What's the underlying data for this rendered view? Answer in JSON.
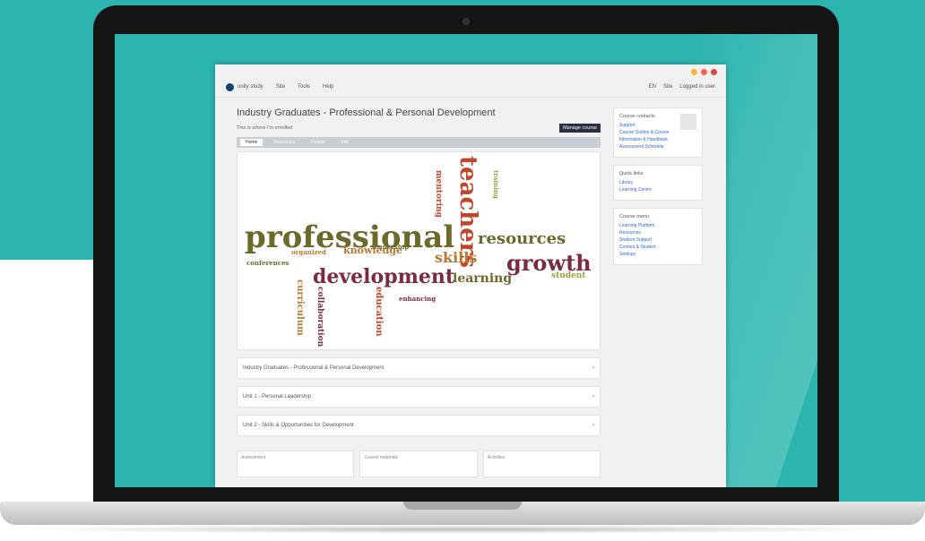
{
  "browser": {
    "traffic_colors": [
      "#f7b733",
      "#ff5f57",
      "#e0443e"
    ]
  },
  "topnav": {
    "brand": "unity study",
    "links": [
      "Site",
      "Tools",
      "Help"
    ],
    "right_items": [
      "EN",
      "Site",
      "Logged in user"
    ]
  },
  "page": {
    "title": "Industry Graduates - Professional & Personal Development",
    "subtitle": "This is where I'm enrolled",
    "action_button": "Manage course"
  },
  "tabs": [
    "Home",
    "Resources",
    "People",
    "Info"
  ],
  "wordcloud": {
    "words": [
      {
        "text": "professional",
        "color": "#6b6a2b"
      },
      {
        "text": "teachers",
        "color": "#c0462b"
      },
      {
        "text": "resources",
        "color": "#6b6a2b"
      },
      {
        "text": "growth",
        "color": "#7a2b3f"
      },
      {
        "text": "development",
        "color": "#7a2b3f"
      },
      {
        "text": "skills",
        "color": "#b9772e"
      },
      {
        "text": "learning",
        "color": "#6b6a2b"
      },
      {
        "text": "knowledge",
        "color": "#b9772e"
      },
      {
        "text": "student",
        "color": "#9aa43a"
      },
      {
        "text": "education",
        "color": "#c0462b"
      },
      {
        "text": "curriculum",
        "color": "#b9772e"
      },
      {
        "text": "conferences",
        "color": "#6b6a2b"
      },
      {
        "text": "collaboration",
        "color": "#7a2b3f"
      },
      {
        "text": "organized",
        "color": "#b9772e"
      },
      {
        "text": "mentoring",
        "color": "#c0462b"
      },
      {
        "text": "training",
        "color": "#9aa43a"
      },
      {
        "text": "enhancing",
        "color": "#7a2b3f"
      },
      {
        "text": "leadership",
        "color": "#6b6a2b"
      }
    ]
  },
  "rows": [
    "Industry Graduates - Professional & Personal Development",
    "Unit 1 - Personal Leadership",
    "Unit 2 - Skills & Opportunities for Development"
  ],
  "cards": [
    "Assessment",
    "Course materials",
    "Activities"
  ],
  "sidebar": {
    "box1": {
      "heading": "Course contacts",
      "label": "Support",
      "links": [
        "Course Outline & Course",
        "Information & Handbook",
        "Assessment Schedule"
      ]
    },
    "box2": {
      "heading": "Quick links",
      "links": [
        "Library",
        "Learning Centre"
      ]
    },
    "box3": {
      "heading": "Course menu",
      "links": [
        "Learning Platform",
        "Resources",
        "Student Support",
        "Contact & Student",
        "Settings"
      ]
    }
  }
}
